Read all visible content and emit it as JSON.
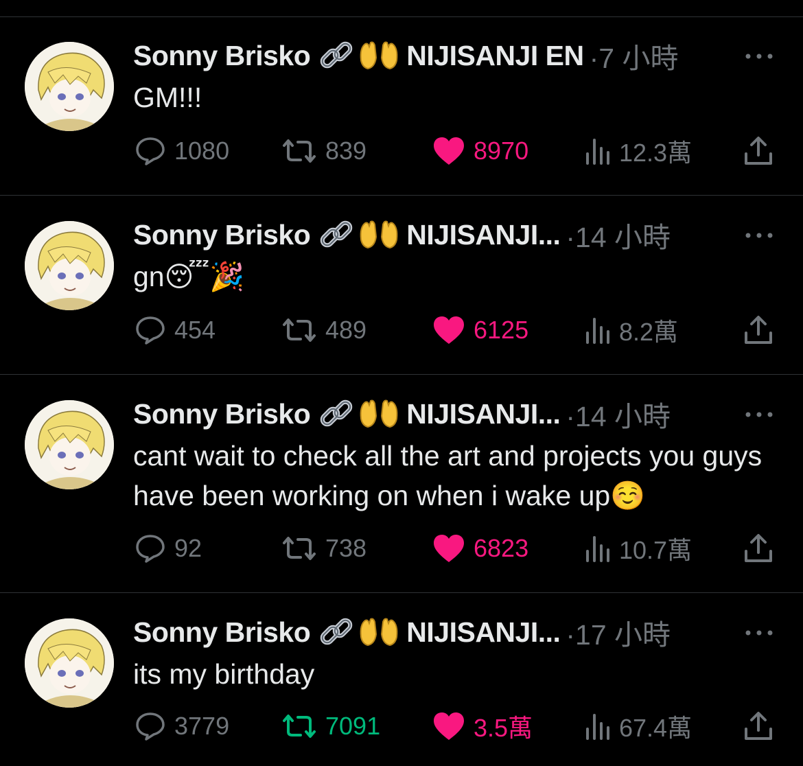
{
  "colors": {
    "background": "#000000",
    "text": "#e7e9ea",
    "muted": "#71767b",
    "like": "#f91880",
    "retweet_active": "#00ba7c",
    "divider": "#2f3336"
  },
  "tweets": [
    {
      "name": "Sonny Brisko",
      "affiliation": "NIJISANJI EN",
      "time": "·7 小時",
      "text": "GM!!!",
      "replies": "1080",
      "retweets": "839",
      "likes": "8970",
      "views": "12.3萬"
    },
    {
      "name": "Sonny Brisko",
      "affiliation": "NIJISANJI...",
      "time": "·14 小時",
      "text": "gn😴🎉",
      "replies": "454",
      "retweets": "489",
      "likes": "6125",
      "views": "8.2萬"
    },
    {
      "name": "Sonny Brisko",
      "affiliation": "NIJISANJI...",
      "time": "·14 小時",
      "text": "cant wait to check all the art and projects you guys have been working on when i wake up☺️",
      "replies": "92",
      "retweets": "738",
      "likes": "6823",
      "views": "10.7萬"
    },
    {
      "name": "Sonny Brisko",
      "affiliation": "NIJISANJI...",
      "time": "·17 小時",
      "text": "its my birthday",
      "replies": "3779",
      "retweets": "7091",
      "likes": "3.5萬",
      "views": "67.4萬",
      "retweeted": true
    }
  ],
  "icons": {
    "avatar": "avatar-image",
    "link": "link-icon",
    "hands": "raising-hands-icon",
    "more": "more-icon",
    "reply": "reply-icon",
    "retweet": "retweet-icon",
    "like": "heart-icon",
    "views": "views-icon",
    "share": "share-icon"
  }
}
